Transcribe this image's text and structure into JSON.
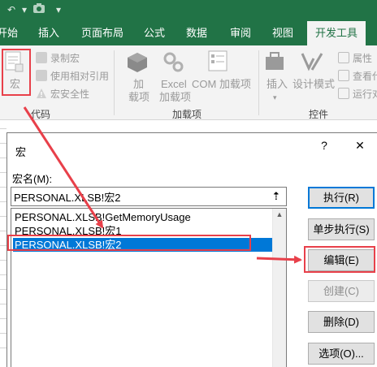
{
  "titlebar": {
    "icons": [
      "undo-icon",
      "redo-icon",
      "camera-icon",
      "customize-qat-icon"
    ]
  },
  "tabs": [
    "开始",
    "插入",
    "页面布局",
    "公式",
    "数据",
    "审阅",
    "视图",
    "开发工具"
  ],
  "ribbon": {
    "code": {
      "macros_label": "宏",
      "record_macro": "录制宏",
      "use_relative": "使用相对引用",
      "macro_security": "宏安全性",
      "group_label": "代码"
    },
    "addins": {
      "addins_line1": "加",
      "addins_line2": "载项",
      "excel_line1": "Excel",
      "excel_line2": "加载项",
      "com_line1": "COM 加载项",
      "group_label": "加载项"
    },
    "controls": {
      "insert": "插入",
      "design_mode": "设计模式",
      "properties": "属性",
      "view_code": "查看代",
      "run_dialog": "运行对",
      "group_label": "控件"
    }
  },
  "dialog": {
    "title": "宏",
    "help_glyph": "?",
    "close_glyph": "✕",
    "name_label": "宏名(M):",
    "name_value": "PERSONAL.XLSB!宏2",
    "up_glyph": "⇡",
    "macros": [
      "PERSONAL.XLSB!GetMemoryUsage",
      "PERSONAL.XLSB!宏1",
      "PERSONAL.XLSB!宏2"
    ],
    "selected_macro": "PERSONAL.XLSB!宏2",
    "buttons": {
      "run": "执行(R)",
      "step_into": "单步执行(S)",
      "edit": "编辑(E)",
      "create": "创建(C)",
      "delete": "删除(D)",
      "options": "选项(O)..."
    }
  },
  "colors": {
    "excel_green": "#217346",
    "annotation_red": "#e8404a",
    "selection_blue": "#0078d7"
  }
}
